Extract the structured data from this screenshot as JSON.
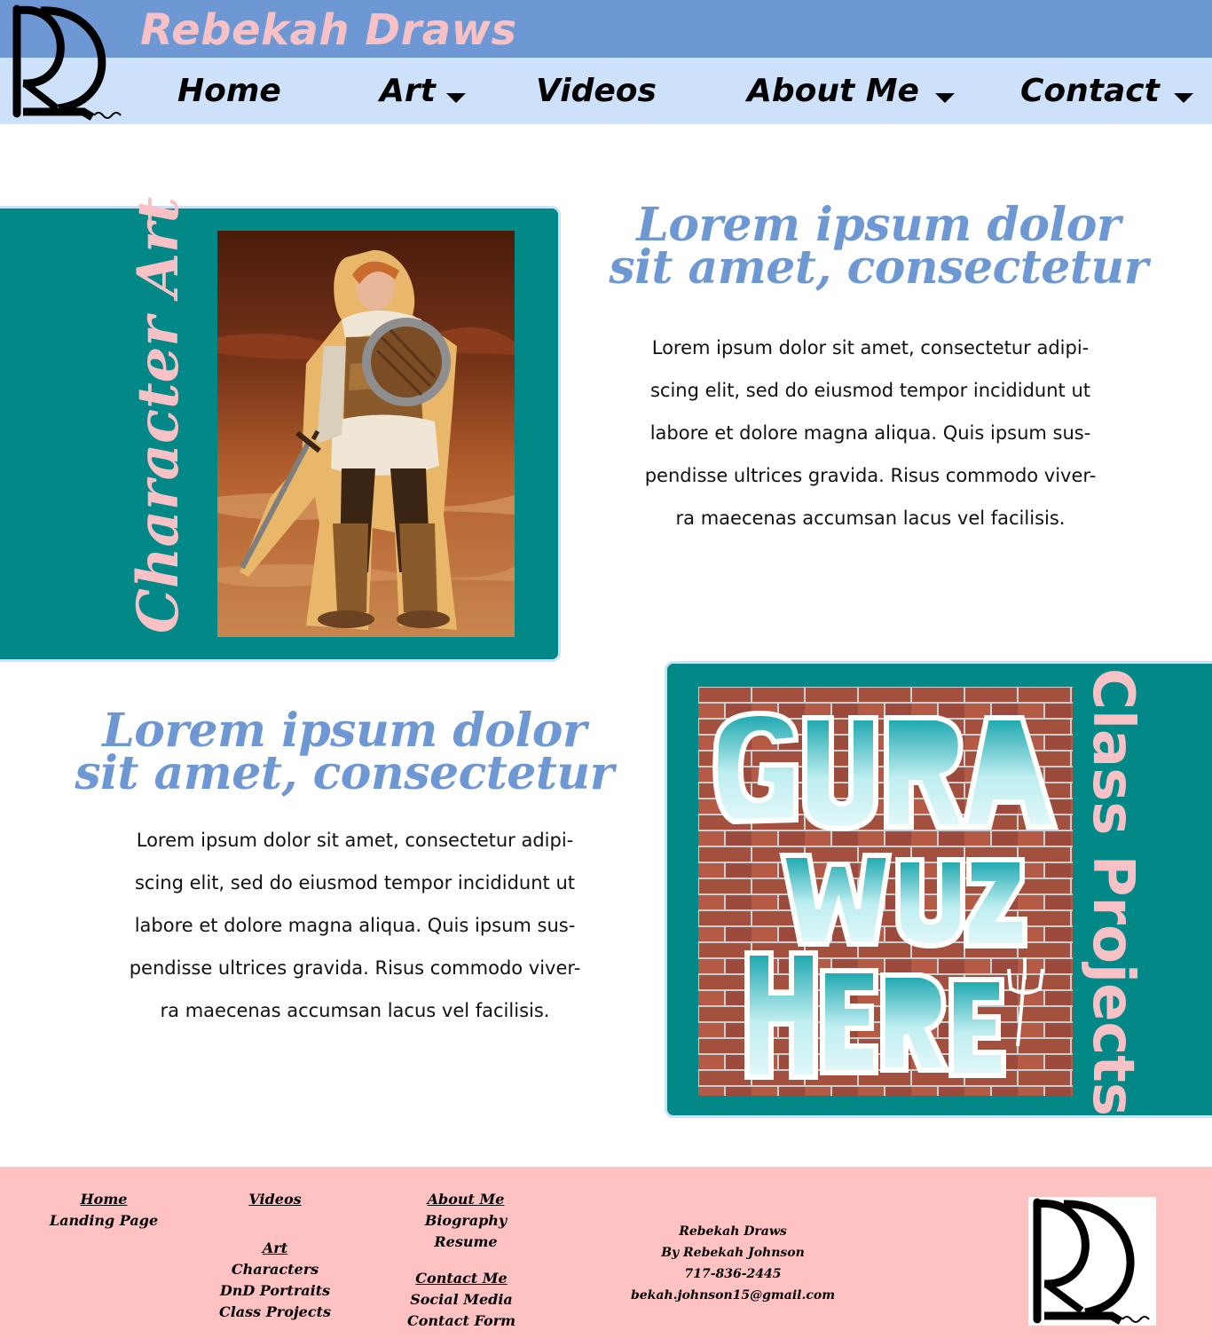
{
  "site": {
    "title": "Rebekah Draws"
  },
  "nav": {
    "items": [
      {
        "label": "Home"
      },
      {
        "label": "Art"
      },
      {
        "label": "Videos"
      },
      {
        "label": "About Me"
      },
      {
        "label": "Contact"
      }
    ]
  },
  "sections": [
    {
      "label": "Character Art",
      "heading_line1": "Lorem ipsum dolor",
      "heading_line2": "sit amet, consectetur",
      "body_lines": [
        "Lorem ipsum dolor sit amet, consectetur adipi-",
        "scing elit, sed do eiusmod tempor incididunt ut",
        "labore et dolore magna aliqua. Quis ipsum sus-",
        "pendisse ultrices gravida. Risus commodo viver-",
        "ra maecenas accumsan lacus vel facilisis."
      ]
    },
    {
      "label": "Class Projects",
      "heading_line1": "Lorem ipsum dolor",
      "heading_line2": "sit amet, consectetur",
      "body_lines": [
        "Lorem ipsum dolor sit amet, consectetur adipi-",
        "scing elit, sed do eiusmod tempor incididunt ut",
        "labore et dolore magna aliqua. Quis ipsum sus-",
        "pendisse ultrices gravida. Risus commodo viver-",
        "ra maecenas accumsan lacus vel facilisis."
      ]
    }
  ],
  "footer": {
    "home": {
      "link": "Home",
      "sub": [
        "Landing Page"
      ]
    },
    "videos": {
      "link": "Videos"
    },
    "art": {
      "link": "Art",
      "sub": [
        "Characters",
        "DnD Portraits",
        "Class Projects"
      ]
    },
    "about": {
      "link": "About Me",
      "sub": [
        "Biography",
        "Resume"
      ]
    },
    "contact": {
      "link": "Contact Me",
      "sub": [
        "Social Media",
        "Contact Form"
      ]
    },
    "info": [
      "Rebekah Draws",
      "By Rebekah Johnson",
      "717-836-2445",
      "bekah.johnson15@gmail.com"
    ]
  },
  "colors": {
    "header_dark": "#6e98d4",
    "header_light": "#cde1fa",
    "title_pink": "#f7c1c6",
    "panel_teal": "#018887",
    "footer_pink": "#fec2c3"
  }
}
